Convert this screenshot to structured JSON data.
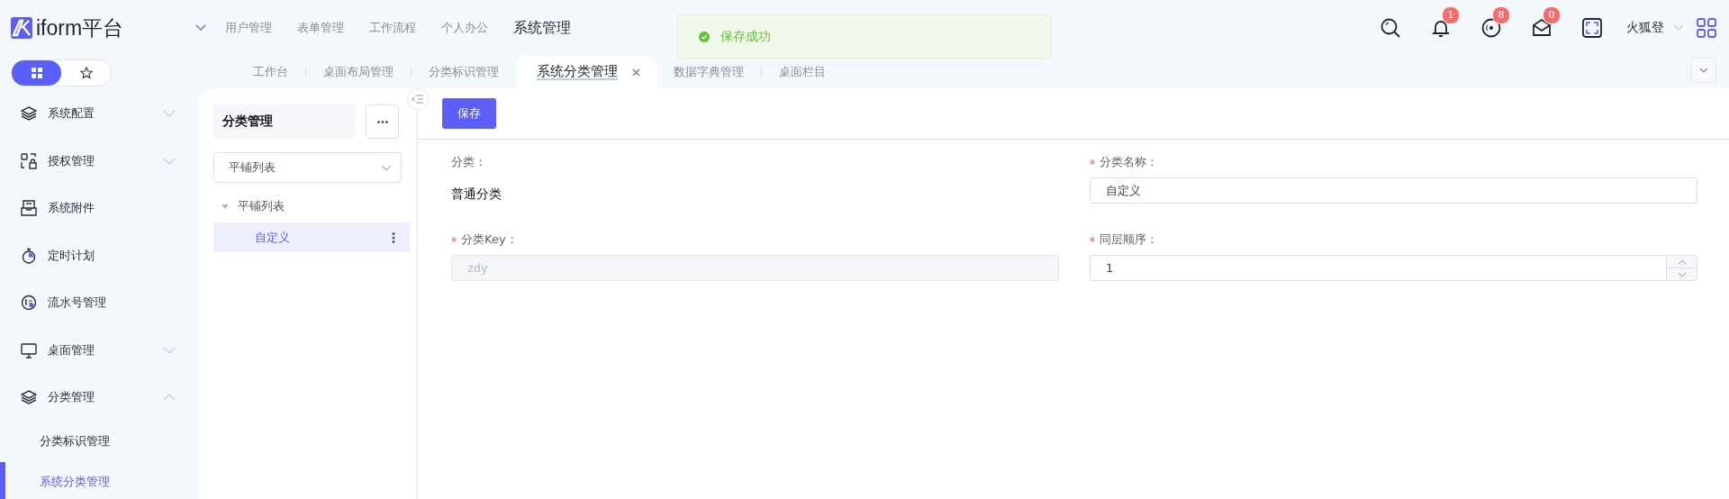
{
  "brand": {
    "name": "iform平台"
  },
  "top_nav": [
    {
      "label": "用户管理",
      "selected": false
    },
    {
      "label": "表单管理",
      "selected": false
    },
    {
      "label": "工作流程",
      "selected": false
    },
    {
      "label": "个人办公",
      "selected": false
    },
    {
      "label": "系统管理",
      "selected": true
    }
  ],
  "toast": {
    "message": "保存成功"
  },
  "header_icons": [
    {
      "kind": "search"
    },
    {
      "kind": "bell",
      "badge": "1"
    },
    {
      "kind": "disc",
      "badge": "8"
    },
    {
      "kind": "mail",
      "badge": "0"
    },
    {
      "kind": "fullscreen"
    }
  ],
  "user": {
    "name": "火狐登"
  },
  "sidebar_toggle": [
    {
      "kind": "grid",
      "selected": true
    },
    {
      "kind": "star",
      "selected": false
    }
  ],
  "tabs": [
    {
      "label": "工作台",
      "selected": false
    },
    {
      "label": "桌面布局管理",
      "selected": false
    },
    {
      "label": "分类标识管理",
      "selected": false
    },
    {
      "label": "系统分类管理",
      "selected": true
    },
    {
      "label": "数据字典管理",
      "selected": false
    },
    {
      "label": "桌面栏目",
      "selected": false
    }
  ],
  "sidebar": {
    "items": [
      {
        "kind": "group",
        "label": "系统配置",
        "expanded": false
      },
      {
        "kind": "group",
        "label": "授权管理",
        "expanded": false
      },
      {
        "kind": "link",
        "label": "系统附件"
      },
      {
        "kind": "link",
        "label": "定时计划"
      },
      {
        "kind": "link",
        "label": "流水号管理"
      },
      {
        "kind": "group",
        "label": "桌面管理",
        "expanded": false
      },
      {
        "kind": "group",
        "label": "分类管理",
        "expanded": true,
        "children": [
          {
            "label": "分类标识管理",
            "selected": false
          },
          {
            "label": "系统分类管理",
            "selected": true
          }
        ]
      }
    ]
  },
  "tree_panel": {
    "title": "分类管理",
    "select": {
      "value": "平铺列表"
    },
    "tree": [
      {
        "label": "平铺列表",
        "expanded": true,
        "children": [
          {
            "label": "自定义",
            "selected": true
          }
        ]
      }
    ]
  },
  "form": {
    "save_button": "保存",
    "fields": [
      {
        "kind": "static",
        "label": "分类：",
        "required": false,
        "value": "普通分类"
      },
      {
        "kind": "text",
        "label": "分类名称：",
        "required": true,
        "value": "自定义",
        "disabled": false
      },
      {
        "kind": "text",
        "label": "分类Key：",
        "required": true,
        "value": "zdy",
        "disabled": true
      },
      {
        "kind": "number",
        "label": "同层顺序：",
        "required": true,
        "value": "1",
        "disabled": false
      }
    ]
  }
}
